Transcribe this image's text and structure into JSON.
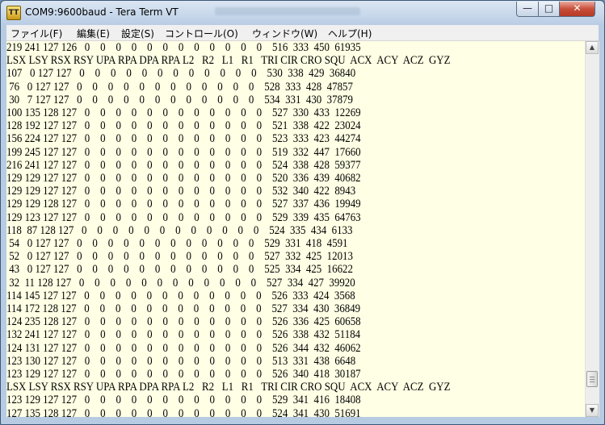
{
  "window": {
    "title": "COM9:9600baud - Tera Term VT",
    "icon": "teraterm-app-icon",
    "controls": {
      "minimize": "—",
      "maximize": "□",
      "close": "✕"
    }
  },
  "menu": [
    {
      "label": "ファイル(F)"
    },
    {
      "label": "編集(E)"
    },
    {
      "label": "設定(S)"
    },
    {
      "label": "コントロール(O)"
    },
    {
      "label": "ウィンドウ(W)"
    },
    {
      "label": "ヘルプ(H)"
    }
  ],
  "terminal": {
    "lines": [
      "219 241 127 126   0    0    0    0    0    0    0    0    0    0    0    0    516  333  450  61935",
      "LSX LSY RSX RSY UPA RPA DPA RPA L2   R2   L1   R1   TRI CIR CRO SQU  ACX  ACY  ACZ  GYZ",
      "107   0 127 127   0    0    0    0    0    0    0    0    0    0    0    0    530  338  429  36840",
      " 76   0 127 127   0    0    0    0    0    0    0    0    0    0    0    0    528  333  428  47857",
      " 30   7 127 127   0    0    0    0    0    0    0    0    0    0    0    0    534  331  430  37879",
      "100 135 128 127   0    0    0    0    0    0    0    0    0    0    0    0    527  330  433  12269",
      "128 192 127 127   0    0    0    0    0    0    0    0    0    0    0    0    521  338  422  23024",
      "156 224 127 127   0    0    0    0    0    0    0    0    0    0    0    0    523  333  423  44274",
      "199 245 127 127   0    0    0    0    0    0    0    0    0    0    0    0    519  332  447  17660",
      "216 241 127 127   0    0    0    0    0    0    0    0    0    0    0    0    524  338  428  59377",
      "129 129 127 127   0    0    0    0    0    0    0    0    0    0    0    0    520  336  439  40682",
      "129 129 127 127   0    0    0    0    0    0    0    0    0    0    0    0    532  340  422  8943",
      "129 129 128 127   0    0    0    0    0    0    0    0    0    0    0    0    527  337  436  19949",
      "129 123 127 127   0    0    0    0    0    0    0    0    0    0    0    0    529  339  435  64763",
      "118  87 128 127   0    0    0    0    0    0    0    0    0    0    0    0    524  335  434  6133",
      " 54   0 127 127   0    0    0    0    0    0    0    0    0    0    0    0    529  331  418  4591",
      " 52   0 127 127   0    0    0    0    0    0    0    0    0    0    0    0    527  332  425  12013",
      " 43   0 127 127   0    0    0    0    0    0    0    0    0    0    0    0    525  334  425  16622",
      " 32  11 128 127   0    0    0    0    0    0    0    0    0    0    0    0    527  334  427  39920",
      "114 145 127 127   0    0    0    0    0    0    0    0    0    0    0    0    526  333  424  3568",
      "114 172 128 127   0    0    0    0    0    0    0    0    0    0    0    0    527  334  430  36849",
      "124 235 128 127   0    0    0    0    0    0    0    0    0    0    0    0    526  336  425  60658",
      "132 241 127 127   0    0    0    0    0    0    0    0    0    0    0    0    526  338  432  51184",
      "124 131 127 127   0    0    0    0    0    0    0    0    0    0    0    0    526  344  432  46062",
      "123 130 127 127   0    0    0    0    0    0    0    0    0    0    0    0    513  331  438  6648",
      "123 129 127 127   0    0    0    0    0    0    0    0    0    0    0    0    526  340  418  30187",
      "LSX LSY RSX RSY UPA RPA DPA RPA L2   R2   L1   R1   TRI CIR CRO SQU  ACX  ACY  ACZ  GYZ",
      "123 129 127 127   0    0    0    0    0    0    0    0    0    0    0    0    529  341  416  18408",
      "127 135 128 127   0    0    0    0    0    0    0    0    0    0    0    0    524  341  430  51691"
    ]
  },
  "scrollbar": {
    "position_fraction": 0.95
  },
  "colors": {
    "terminal_background": "#ffffe5",
    "terminal_text": "#000000",
    "title_bar": "#c5d6ea",
    "close_button": "#c94f3b"
  }
}
